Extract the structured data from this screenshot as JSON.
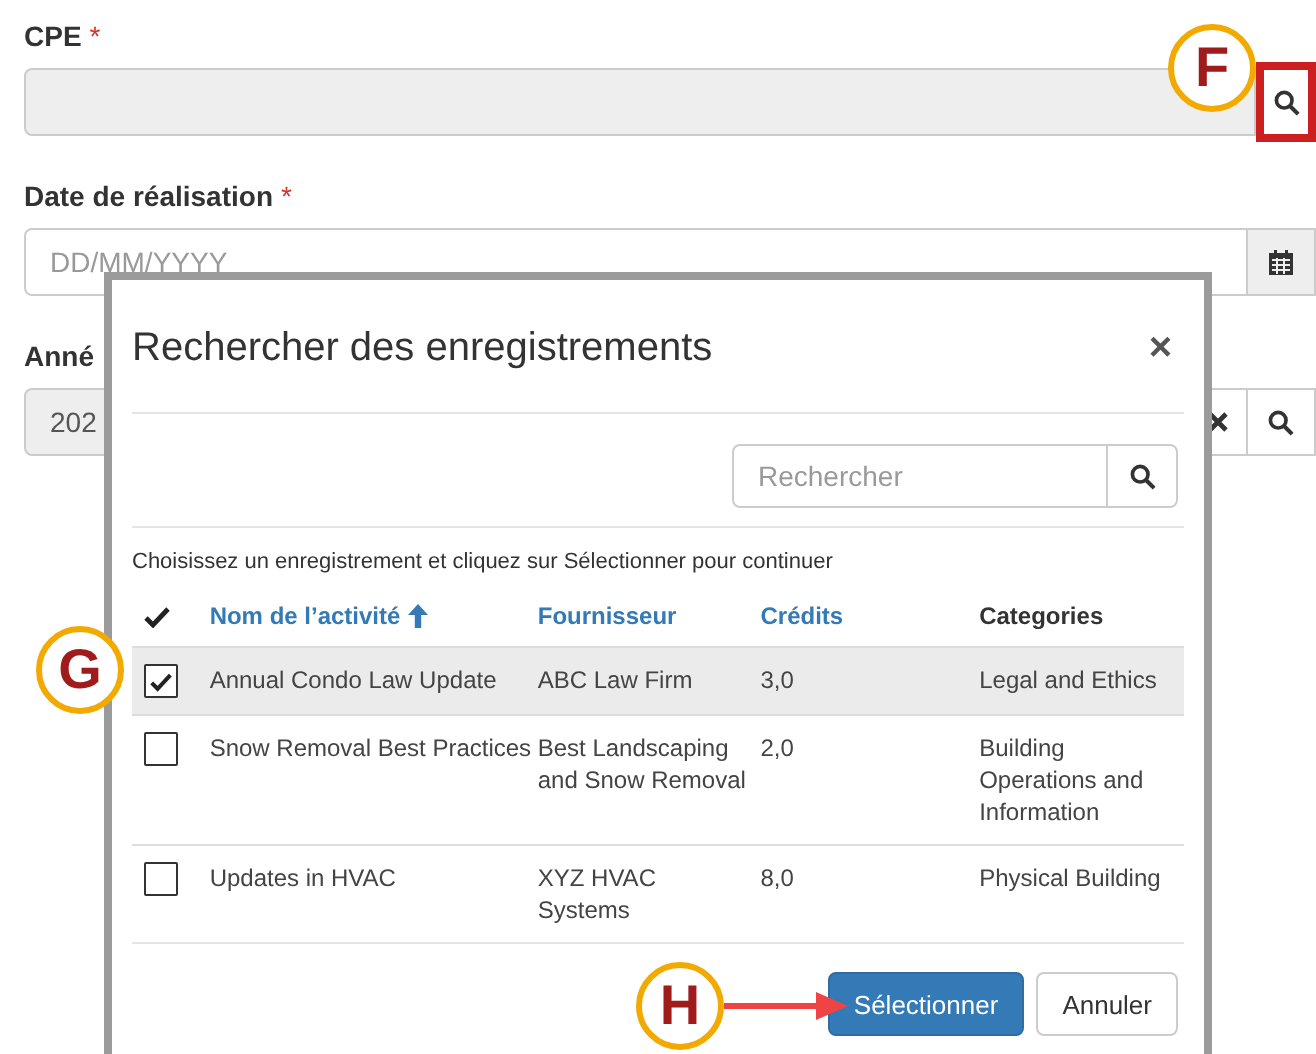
{
  "form": {
    "fields": [
      {
        "label": "CPE",
        "required_mark": "*",
        "kind": "lookup",
        "disabled": true,
        "highlighted": true
      },
      {
        "label": "Date de réalisation",
        "required_mark": "*",
        "kind": "date",
        "disabled": false,
        "placeholder": "DD/MM/YYYY"
      },
      {
        "label": "Anné",
        "kind": "lookup_clear",
        "disabled": true,
        "value": "202"
      }
    ]
  },
  "modal": {
    "title": "Rechercher des enregistrements",
    "close": "×",
    "search": {
      "placeholder": "Rechercher"
    },
    "instructions": "Choisissez un enregistrement et cliquez sur Sélectionner pour continuer",
    "columns": [
      {
        "label": "Nom de l’activité",
        "sortable": true,
        "sort_ascending": true
      },
      {
        "label": "Fournisseur",
        "sortable": true
      },
      {
        "label": "Crédits",
        "sortable": true
      },
      {
        "label": "Categories",
        "sortable": false
      }
    ],
    "rows": [
      {
        "selected": true,
        "cells": [
          "Annual Condo Law Update",
          "ABC Law Firm",
          "3,0",
          "Legal and Ethics"
        ]
      },
      {
        "selected": false,
        "cells": [
          "Snow Removal Best Practices",
          "Best Landscaping and Snow Removal",
          "2,0",
          "Building Operations and Information"
        ]
      },
      {
        "selected": false,
        "cells": [
          "Updates in HVAC",
          "XYZ HVAC Systems",
          "8,0",
          "Physical Building"
        ]
      }
    ],
    "buttons": [
      {
        "label": "Sélectionner",
        "kind": "primary"
      },
      {
        "label": "Annuler",
        "kind": "default"
      }
    ]
  },
  "annotations": [
    {
      "letter": "F"
    },
    {
      "letter": "G"
    },
    {
      "letter": "H",
      "arrow": true
    }
  ]
}
